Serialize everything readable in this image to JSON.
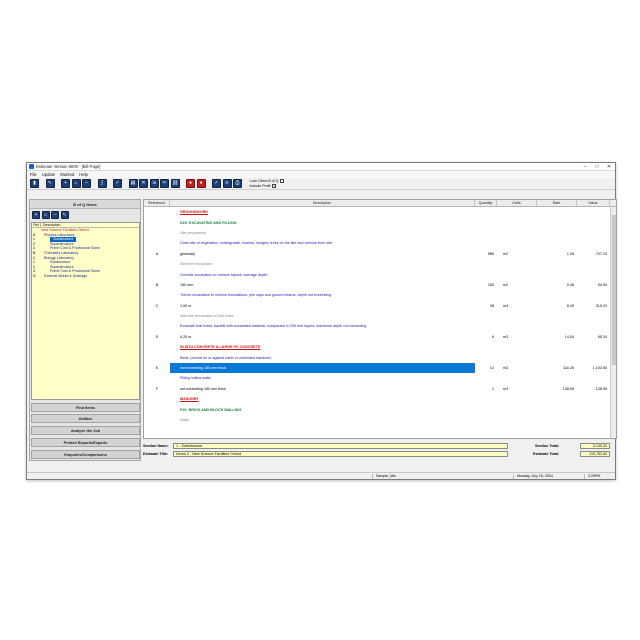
{
  "window": {
    "title": "Estimate Version 8000 - [Bill Page]",
    "minimize": "–",
    "maximize": "□",
    "close": "✕"
  },
  "menu": [
    "File",
    "Update",
    "Marked",
    "Help"
  ],
  "toolbar": {
    "options": {
      "lock_label": "Lock Client B of Q",
      "profit_label": "Include Profit",
      "profit_check": "✓"
    }
  },
  "left_panel": {
    "header": "B of Q Items",
    "tree_headers": {
      "ref": "Ref",
      "description": "Description"
    },
    "tree": [
      {
        "ref": "",
        "label": "New Science Facilities Oxford",
        "indent": 0,
        "kind": "root"
      },
      {
        "ref": "A",
        "label": "Physics Laboratory",
        "indent": 1,
        "kind": "node"
      },
      {
        "ref": "1",
        "label": "Substructure",
        "indent": 3,
        "kind": "selected"
      },
      {
        "ref": "2",
        "label": "Superstructure",
        "indent": 3,
        "kind": "node"
      },
      {
        "ref": "3",
        "label": "Prime Cost & Provisional Sums",
        "indent": 3,
        "kind": "node"
      },
      {
        "ref": "B",
        "label": "Chemistry Laboratory",
        "indent": 1,
        "kind": "node"
      },
      {
        "ref": "C",
        "label": "Biology Laboratory",
        "indent": 1,
        "kind": "node"
      },
      {
        "ref": "1",
        "label": "Substructure",
        "indent": 3,
        "kind": "node"
      },
      {
        "ref": "2",
        "label": "Superstructure",
        "indent": 3,
        "kind": "node"
      },
      {
        "ref": "3",
        "label": "Prime Cost & Provisional Sums",
        "indent": 3,
        "kind": "node"
      },
      {
        "ref": "D",
        "label": "External Works & Drainage",
        "indent": 1,
        "kind": "node"
      }
    ],
    "nav": [
      "Find Items",
      "Utilities",
      "Analyse the Job",
      "Printed Reports/Exports",
      "Enquiries/Comparisons"
    ]
  },
  "grid": {
    "headers": {
      "ref": "Reference",
      "desc": "Description",
      "qty": "Quantity",
      "unit": "Units",
      "rate": "Rate",
      "value": "Value"
    },
    "rows": [
      {
        "ref": "",
        "desc": "GROUNDWORK",
        "qty": "",
        "unit": "",
        "rate": "",
        "value": "",
        "style": "heading"
      },
      {
        "ref": "",
        "desc": "D20: EXCAVATING AND FILLING",
        "qty": "",
        "unit": "",
        "rate": "",
        "value": "",
        "style": "subheading"
      },
      {
        "ref": "",
        "desc": "Site preparation",
        "qty": "",
        "unit": "",
        "rate": "",
        "value": "",
        "style": "note"
      },
      {
        "ref": "",
        "desc": "Clear site of vegetation, undergrowth, bushes, hedges, trees on the like and remove from site.",
        "qty": "",
        "unit": "",
        "rate": "",
        "value": "",
        "style": "spec"
      },
      {
        "ref": "A",
        "desc": "generally",
        "qty": "585",
        "unit": "m2",
        "rate": "1.26",
        "value": "737.10",
        "style": "item"
      },
      {
        "ref": "",
        "desc": "Machine excavation",
        "qty": "",
        "unit": "",
        "rate": "",
        "value": "",
        "style": "note"
      },
      {
        "ref": "",
        "desc": "Oversite excavation to remove topsoil, average depth:",
        "qty": "",
        "unit": "",
        "rate": "",
        "value": "",
        "style": "spec"
      },
      {
        "ref": "B",
        "desc": "150 mm",
        "qty": "150",
        "unit": "m2",
        "rate": "0.36",
        "value": "54.00",
        "style": "item"
      },
      {
        "ref": "",
        "desc": "Trench excavation to receive foundations, pile caps and ground beams, depth not exceeding:",
        "qty": "",
        "unit": "",
        "rate": "",
        "value": "",
        "style": "spec"
      },
      {
        "ref": "C",
        "desc": "1.00 m",
        "qty": "38",
        "unit": "m3",
        "rate": "8.40",
        "value": "319.20",
        "style": "item"
      },
      {
        "ref": "",
        "desc": "Machine excavation of trial holes",
        "qty": "",
        "unit": "",
        "rate": "",
        "value": "",
        "style": "note"
      },
      {
        "ref": "",
        "desc": "Excavate trial holes; backfill with excavated material, compacted in 250 mm layers; maximum depth not exceeding",
        "qty": "",
        "unit": "",
        "rate": "",
        "value": "",
        "style": "spec"
      },
      {
        "ref": "D",
        "desc": "0.25 m",
        "qty": "6",
        "unit": "m3",
        "rate": "14.54",
        "value": "65.34",
        "style": "item"
      },
      {
        "ref": "",
        "desc": "IN SITU CONCRETE & LARGE PC CONCRETE",
        "qty": "",
        "unit": "",
        "rate": "",
        "value": "",
        "style": "heading"
      },
      {
        "ref": "",
        "desc": "Beds; poured on or against earth or unblinded hardcore;",
        "qty": "",
        "unit": "",
        "rate": "",
        "value": "",
        "style": "spec"
      },
      {
        "ref": "E",
        "desc": "not exceeding 150 mm thick",
        "qty": "13",
        "unit": "m3",
        "rate": "116.25",
        "value": "1,102.50",
        "style": "selected"
      },
      {
        "ref": "",
        "desc": "Filling hollow walls;",
        "qty": "",
        "unit": "",
        "rate": "",
        "value": "",
        "style": "spec"
      },
      {
        "ref": "F",
        "desc": "not exceeding 150 mm thick",
        "qty": "1",
        "unit": "m3",
        "rate": "138.95",
        "value": "138.95",
        "style": "item"
      },
      {
        "ref": "",
        "desc": "MASONRY",
        "qty": "",
        "unit": "",
        "rate": "",
        "value": "",
        "style": "heading"
      },
      {
        "ref": "",
        "desc": "F10: BRICK AND BLOCK WALLING",
        "qty": "",
        "unit": "",
        "rate": "",
        "value": "",
        "style": "subheading"
      },
      {
        "ref": "",
        "desc": "Walls",
        "qty": "",
        "unit": "",
        "rate": "",
        "value": "",
        "style": "note"
      }
    ]
  },
  "footer": {
    "section_name_label": "Section Name:",
    "section_name": "1 - Substructure",
    "estimate_title_label": "Estimate Title:",
    "estimate_title": "Demo 2 - New Science Facilities Oxford",
    "section_total_label": "Section Total:",
    "section_total": "3,130.20",
    "estimate_total_label": "Estimate Total:",
    "estimate_total": "115,752.60"
  },
  "status": {
    "user": "Sample_Mw",
    "date": "Monday, July 15, 2024",
    "time": "2:29PM"
  },
  "colors": {
    "navy_button": "#1d3f73",
    "selection": "#0a78d6",
    "tree_bg": "#ffffc8",
    "heading": "#c81010",
    "subheading": "#1a7a3a",
    "spec": "#2020b0"
  }
}
